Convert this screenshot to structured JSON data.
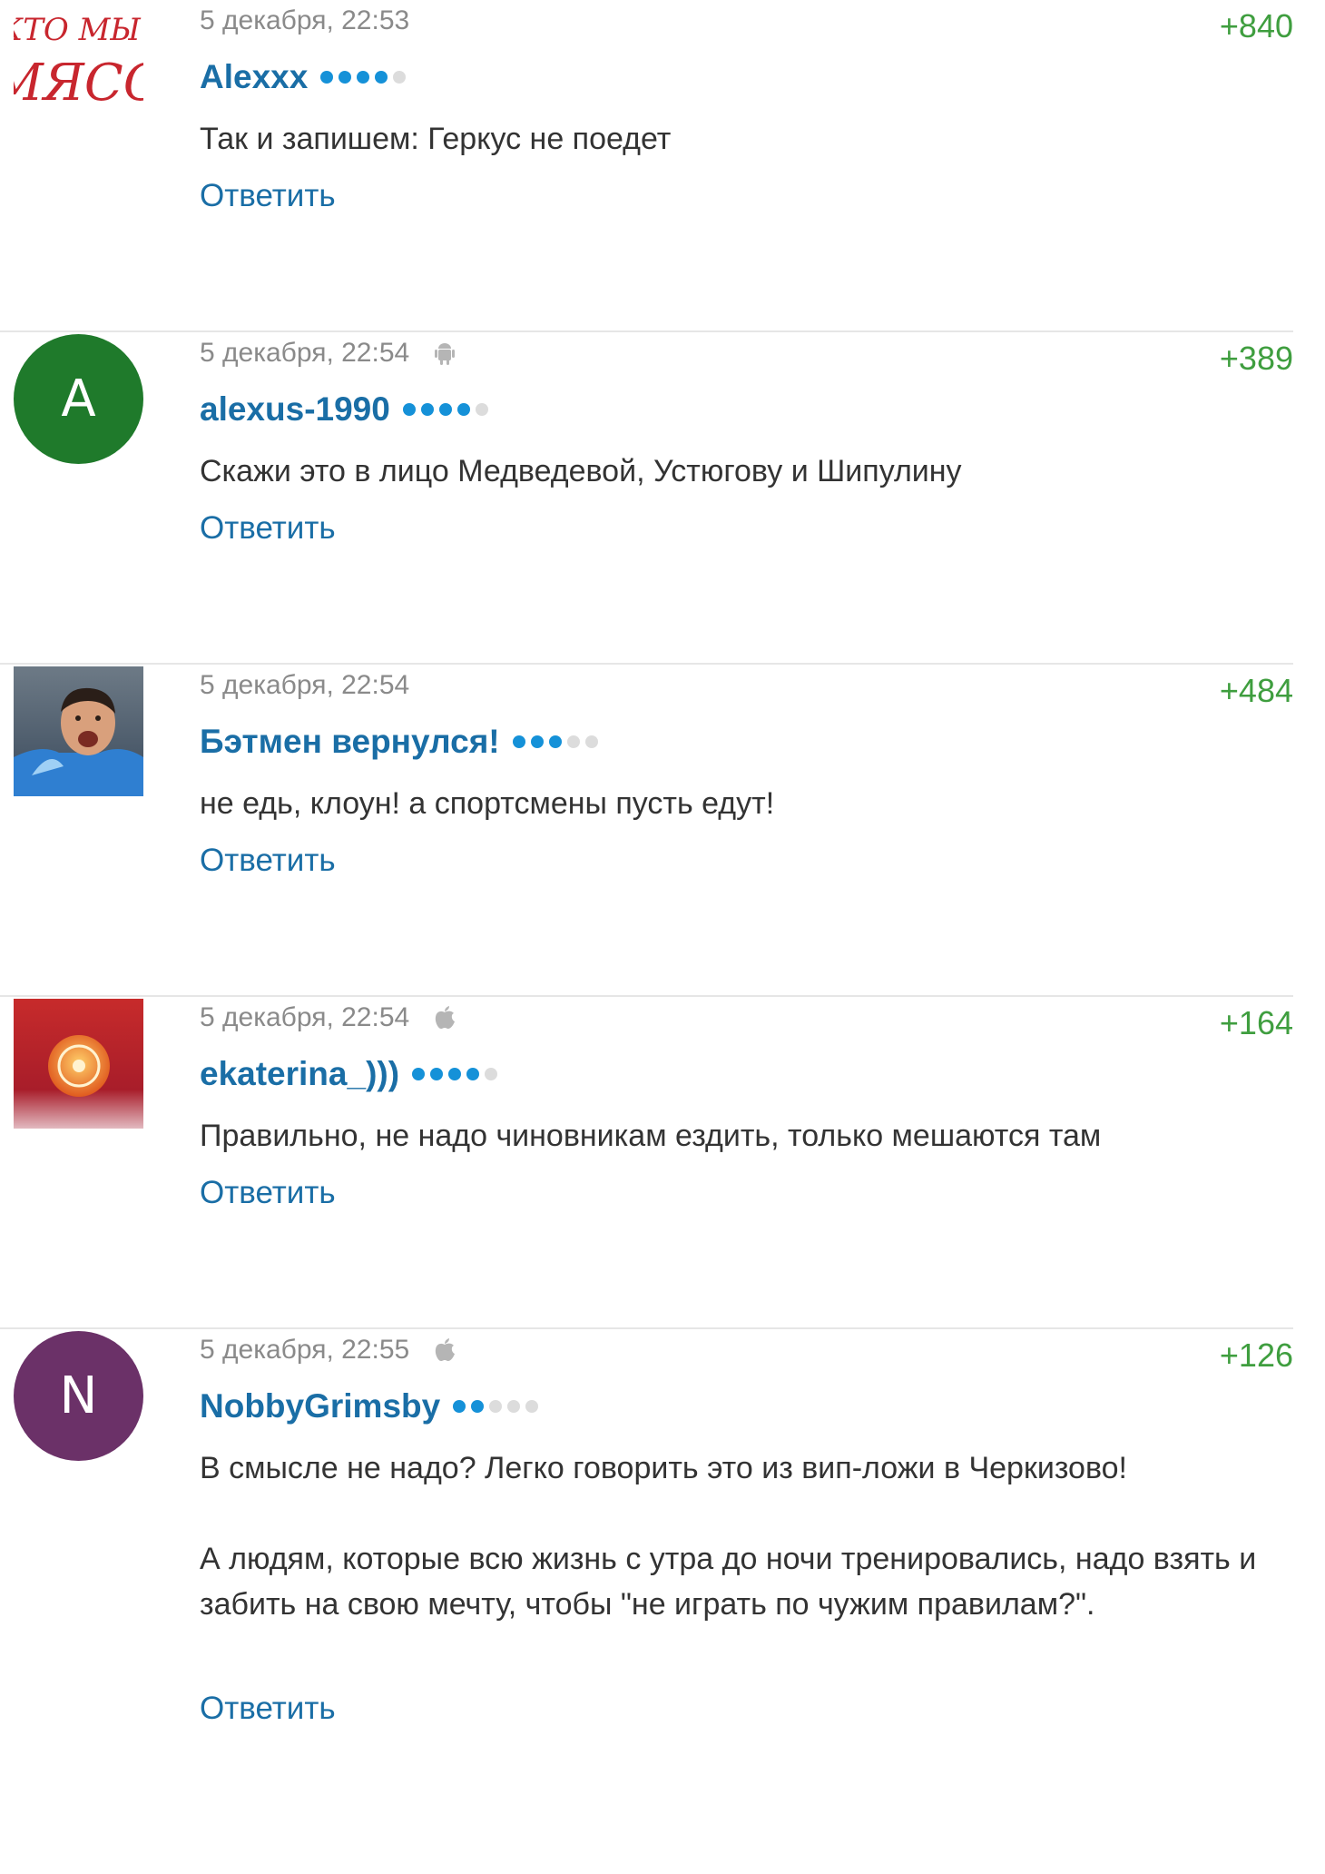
{
  "colors": {
    "username": "#1a6ea6",
    "score": "#3f9e3f",
    "meta": "#8a8a8a",
    "rating_on": "#1591d8",
    "rating_off": "#dcdcdc"
  },
  "comments": [
    {
      "avatar": {
        "type": "image",
        "icon": "kto-my-myaso-avatar",
        "lines": [
          "КТО МЫ?",
          "МЯСО"
        ]
      },
      "date": "5 декабря, 22:53",
      "platform": "",
      "score": "+840",
      "username": "Alexxx",
      "rating": 4,
      "text": [
        "Так и запишем: Геркус не поедет"
      ],
      "reply": "Ответить"
    },
    {
      "avatar": {
        "type": "letter",
        "letter": "A",
        "color": "#1f7a2b"
      },
      "date": "5 декабря, 22:54",
      "platform": "android-icon",
      "score": "+389",
      "username": "alexus-1990",
      "rating": 4,
      "text": [
        "Скажи это в лицо Медведевой, Устюгову и Шипулину"
      ],
      "reply": "Ответить"
    },
    {
      "avatar": {
        "type": "image",
        "icon": "fan-photo-avatar"
      },
      "date": "5 декабря, 22:54",
      "platform": "",
      "score": "+484",
      "username": "Бэтмен вернулся!",
      "rating": 3,
      "text": [
        "не едь, клоун! а спортсмены пусть едут!"
      ],
      "reply": "Ответить"
    },
    {
      "avatar": {
        "type": "image",
        "icon": "club-crest-avatar"
      },
      "date": "5 декабря, 22:54",
      "platform": "apple-icon",
      "score": "+164",
      "username": "ekaterina_)))",
      "rating": 4,
      "text": [
        "Правильно, не надо чиновникам ездить, только мешаются там"
      ],
      "reply": "Ответить"
    },
    {
      "avatar": {
        "type": "letter",
        "letter": "N",
        "color": "#6b3168"
      },
      "date": "5 декабря, 22:55",
      "platform": "apple-icon",
      "score": "+126",
      "username": "NobbyGrimsby",
      "rating": 2,
      "text": [
        "В смысле не надо? Легко говорить это из вип-ложи в Черкизово!",
        "А людям, которые всю жизнь с утра до ночи тренировались, надо взять и забить на свою мечту, чтобы \"не играть по чужим правилам?\"."
      ],
      "reply": "Ответить"
    }
  ]
}
